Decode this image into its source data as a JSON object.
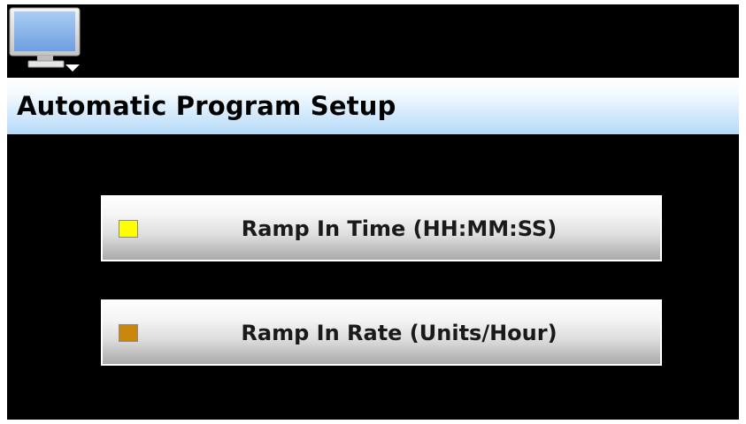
{
  "header": {
    "icon": "monitor-icon",
    "title": "Automatic Program Setup"
  },
  "options": [
    {
      "label": "Ramp In Time (HH:MM:SS)",
      "indicator_color": "#ffff00"
    },
    {
      "label": "Ramp In Rate (Units/Hour)",
      "indicator_color": "#c8860a"
    }
  ],
  "colors": {
    "background": "#000000",
    "title_bar": "#cfe7fb"
  }
}
